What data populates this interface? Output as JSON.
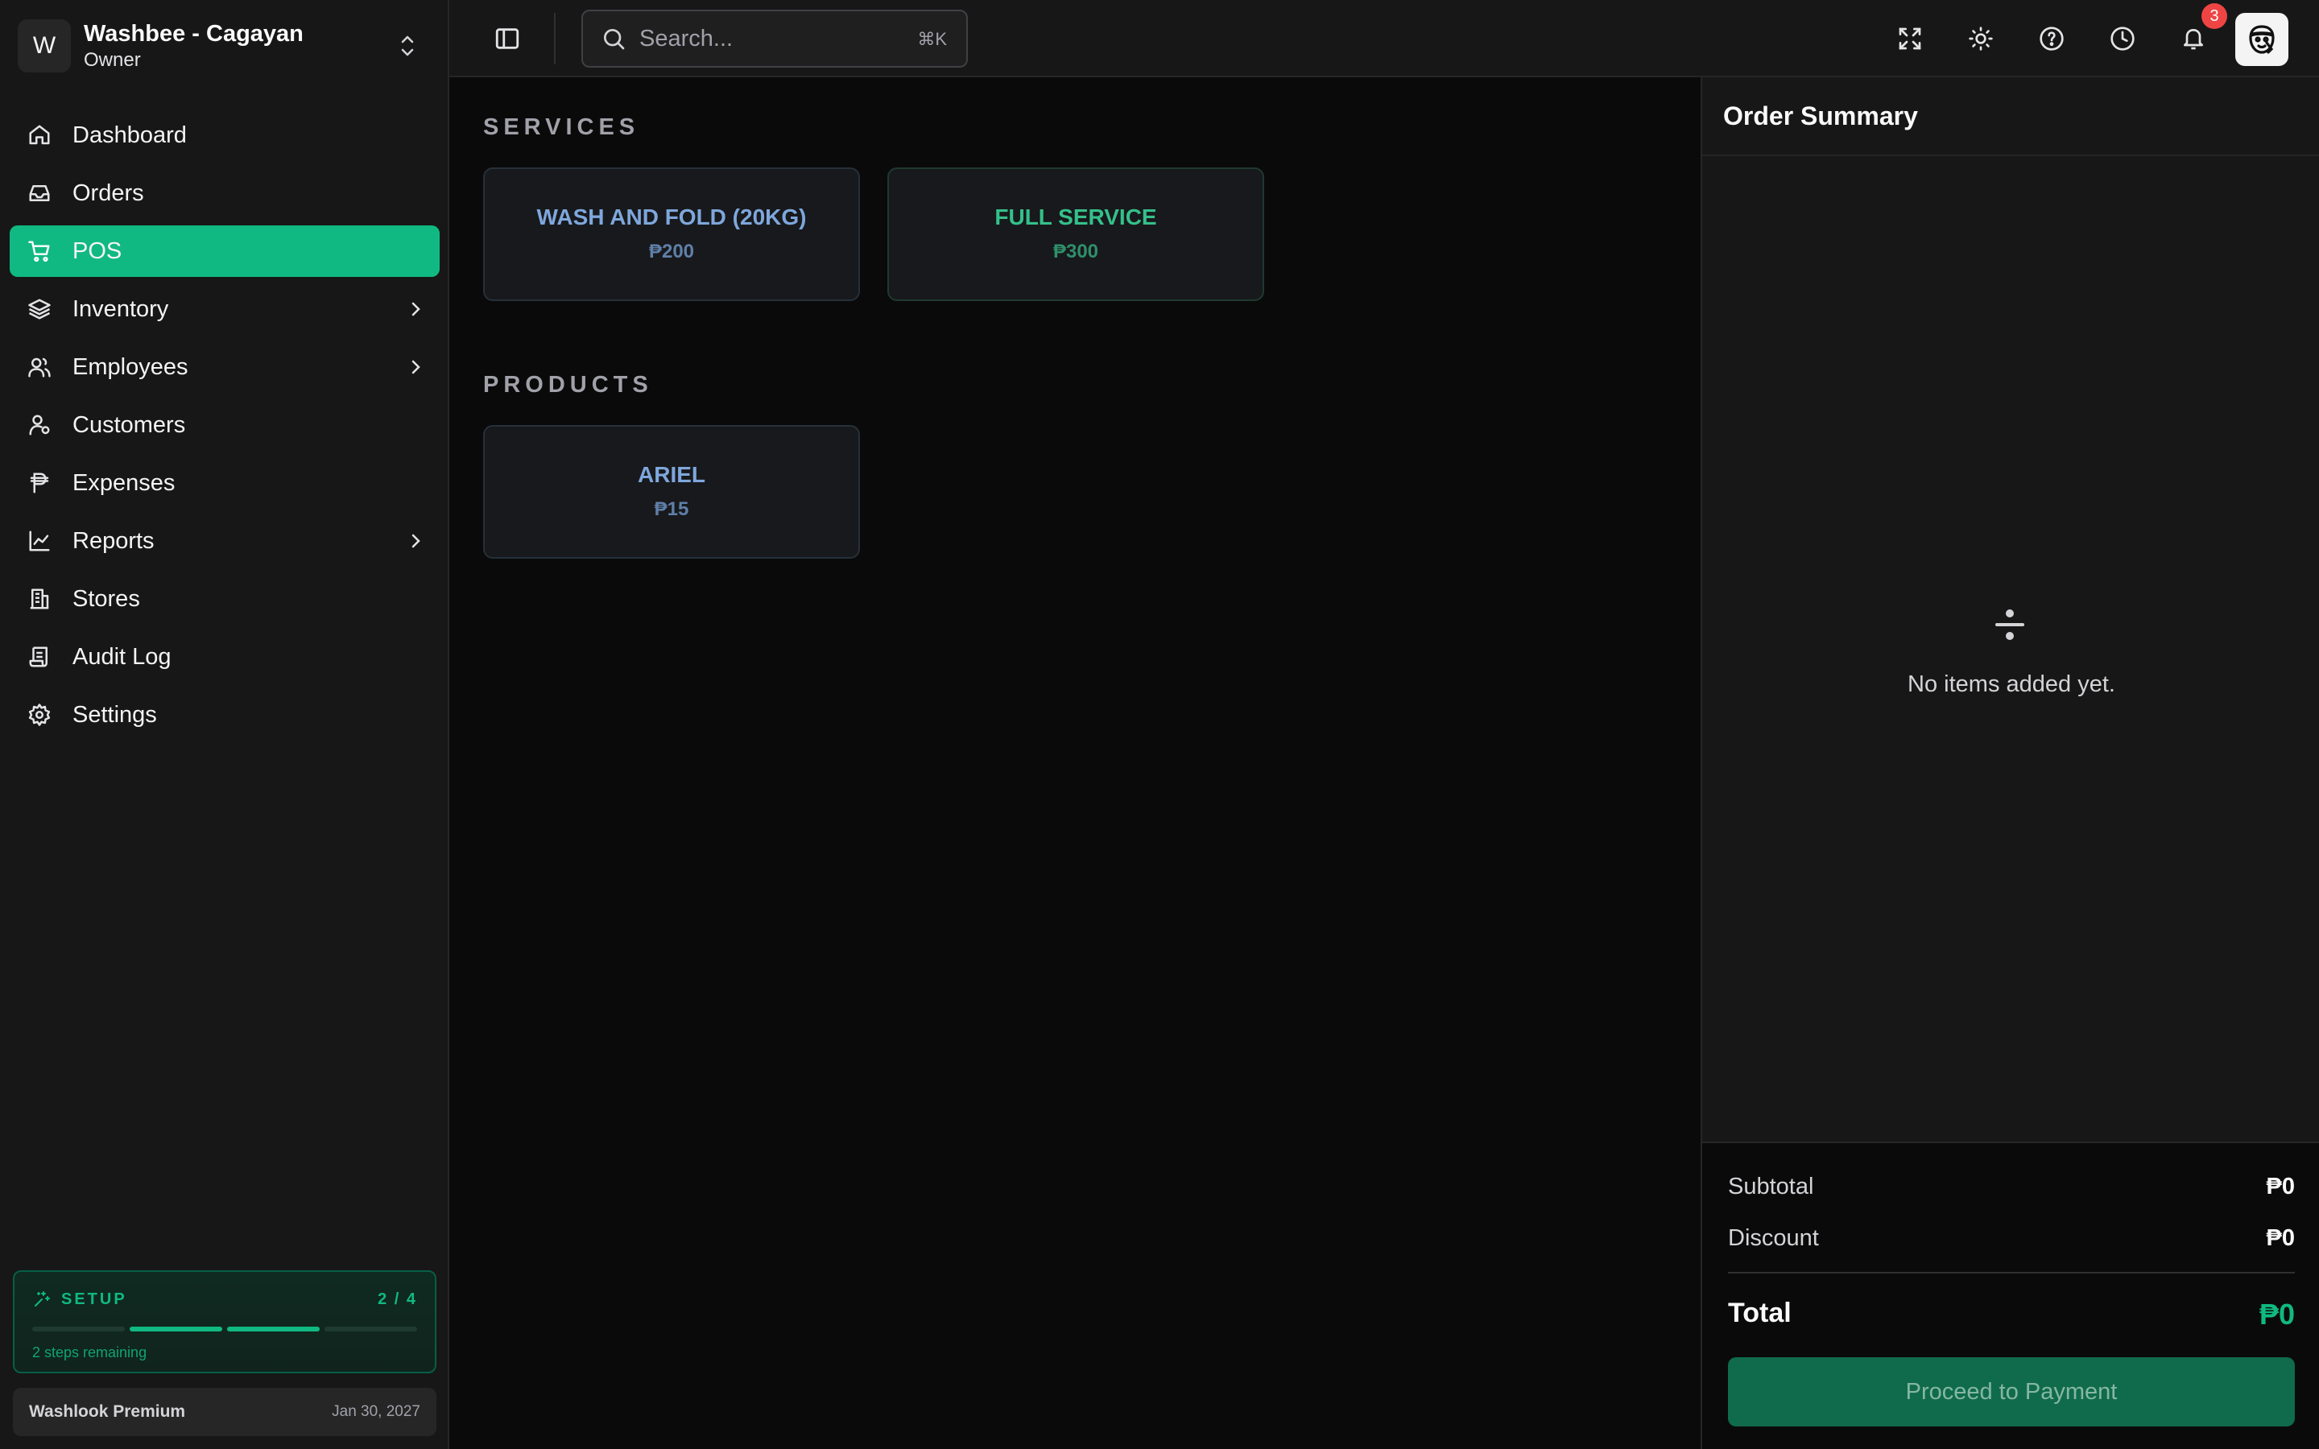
{
  "store": {
    "avatar_letter": "W",
    "name": "Washbee - Cagayan",
    "role": "Owner"
  },
  "nav": {
    "items": [
      {
        "label": "Dashboard",
        "icon": "home-icon"
      },
      {
        "label": "Orders",
        "icon": "inbox-icon"
      },
      {
        "label": "POS",
        "icon": "cart-icon",
        "active": true
      },
      {
        "label": "Inventory",
        "icon": "layers-icon",
        "expandable": true
      },
      {
        "label": "Employees",
        "icon": "users-icon",
        "expandable": true
      },
      {
        "label": "Customers",
        "icon": "user-group-icon"
      },
      {
        "label": "Expenses",
        "icon": "peso-icon"
      },
      {
        "label": "Reports",
        "icon": "chart-icon",
        "expandable": true
      },
      {
        "label": "Stores",
        "icon": "building-icon"
      },
      {
        "label": "Audit Log",
        "icon": "scroll-icon"
      },
      {
        "label": "Settings",
        "icon": "gear-icon"
      }
    ]
  },
  "setup": {
    "title": "SETUP",
    "count": "2 / 4",
    "completed": 2,
    "total": 4,
    "remaining": "2 steps remaining"
  },
  "plan": {
    "name": "Washlook Premium",
    "date": "Jan 30, 2027"
  },
  "header": {
    "search_placeholder": "Search...",
    "search_shortcut": "⌘K",
    "notification_count": "3"
  },
  "main": {
    "services_title": "SERVICES",
    "services": [
      {
        "name": "WASH AND FOLD (20KG)",
        "price": "₱200"
      },
      {
        "name": "FULL SERVICE",
        "price": "₱300"
      }
    ],
    "products_title": "PRODUCTS",
    "products": [
      {
        "name": "ARIEL",
        "price": "₱15"
      }
    ]
  },
  "order": {
    "title": "Order Summary",
    "empty_text": "No items added yet.",
    "subtotal_label": "Subtotal",
    "subtotal_value": "₱0",
    "discount_label": "Discount",
    "discount_value": "₱0",
    "total_label": "Total",
    "total_value": "₱0",
    "pay_button": "Proceed to Payment"
  },
  "colors": {
    "accent": "#10b981",
    "badge": "#ef4444",
    "service_blue": "#7ea7dc",
    "service_green": "#34c08a"
  }
}
